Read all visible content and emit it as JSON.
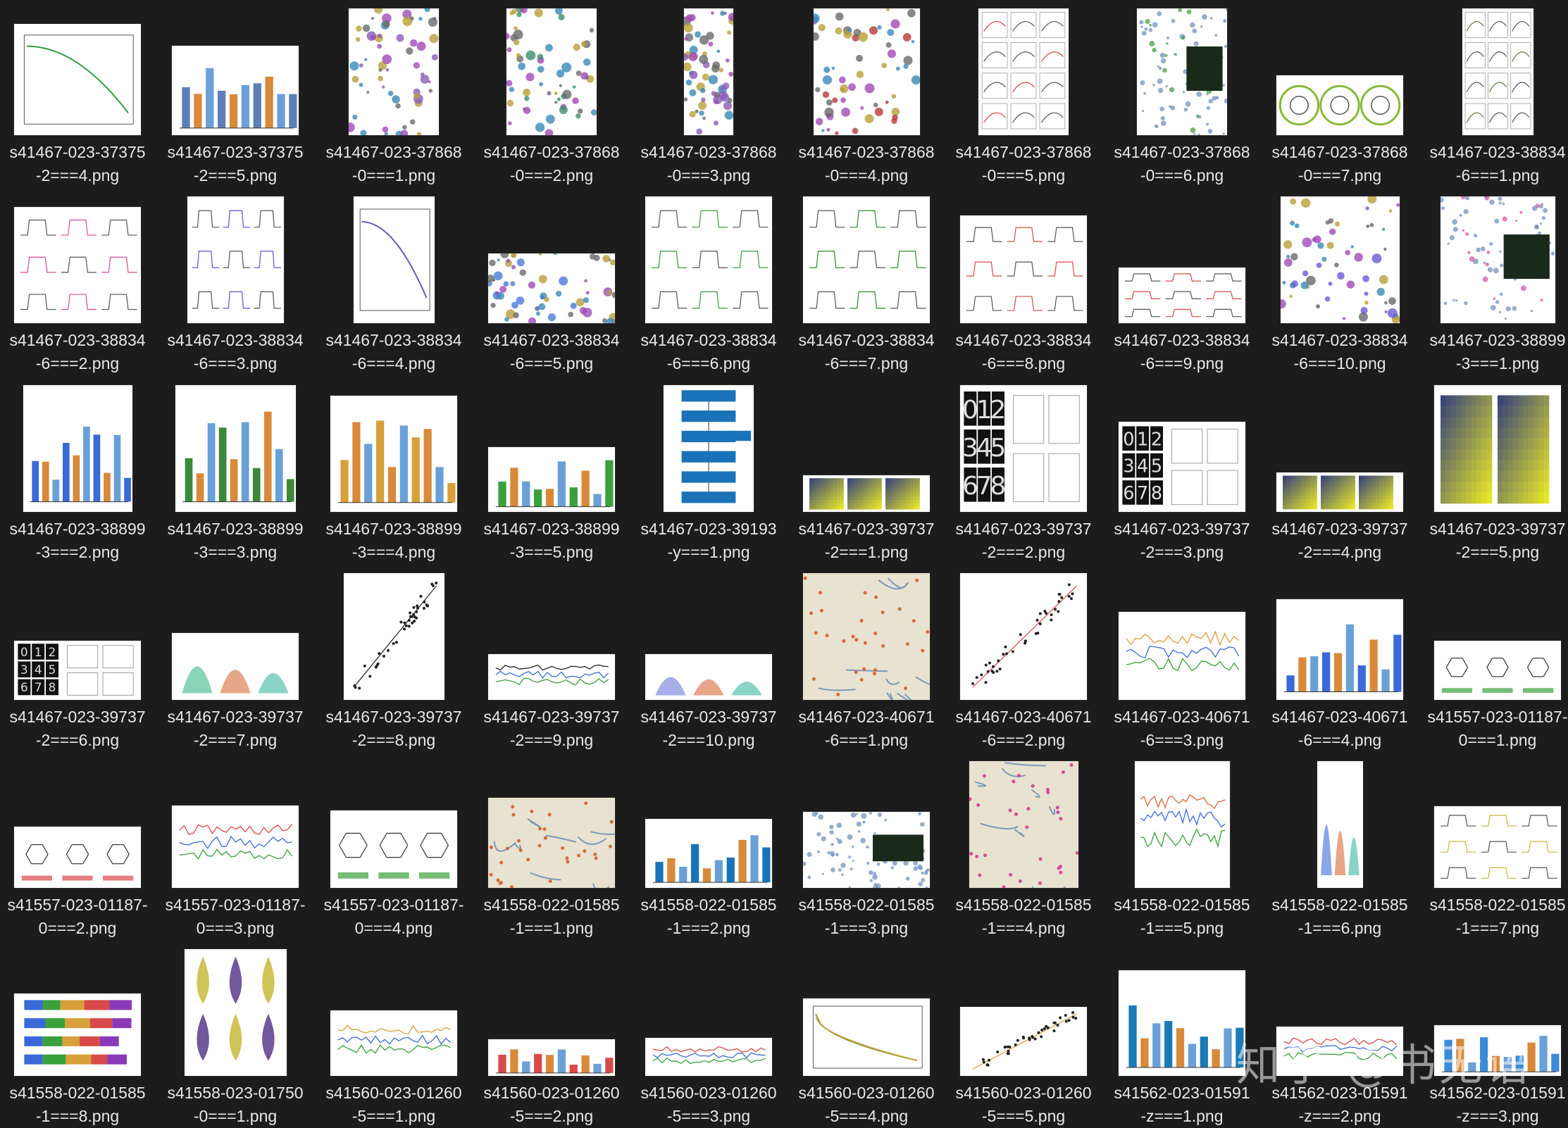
{
  "watermark": "知乎 @书无语",
  "files": [
    {
      "name": "s41467-023-37375-2===4.png",
      "w": 180,
      "h": 158,
      "kind": "curve",
      "accent": "#2ea043"
    },
    {
      "name": "s41467-023-37375-2===5.png",
      "w": 180,
      "h": 127,
      "kind": "bars",
      "accent": "#5b7fb8"
    },
    {
      "name": "s41467-023-37868-0===1.png",
      "w": 128,
      "h": 180,
      "kind": "cluster",
      "accent": "#8a5cb8"
    },
    {
      "name": "s41467-023-37868-0===2.png",
      "w": 128,
      "h": 180,
      "kind": "cluster",
      "accent": "#3a8f6a"
    },
    {
      "name": "s41467-023-37868-0===3.png",
      "w": 70,
      "h": 180,
      "kind": "cluster",
      "accent": "#8a5cb8"
    },
    {
      "name": "s41467-023-37868-0===4.png",
      "w": 151,
      "h": 180,
      "kind": "cluster",
      "accent": "#b83a3a"
    },
    {
      "name": "s41467-023-37868-0===5.png",
      "w": 128,
      "h": 180,
      "kind": "panels",
      "accent": "#d84040"
    },
    {
      "name": "s41467-023-37868-0===6.png",
      "w": 128,
      "h": 180,
      "kind": "dots",
      "accent": "#3a9a3a"
    },
    {
      "name": "s41467-023-37868-0===7.png",
      "w": 180,
      "h": 85,
      "kind": "ring",
      "accent": "#8ab83a"
    },
    {
      "name": "s41467-023-38834-6===1.png",
      "w": 101,
      "h": 180,
      "kind": "panels",
      "accent": "#5a7a3a"
    },
    {
      "name": "s41467-023-38834-6===2.png",
      "w": 180,
      "h": 165,
      "kind": "traces",
      "accent": "#d84a9a"
    },
    {
      "name": "s41467-023-38834-6===3.png",
      "w": 137,
      "h": 180,
      "kind": "traces",
      "accent": "#6a4ad8"
    },
    {
      "name": "s41467-023-38834-6===4.png",
      "w": 115,
      "h": 180,
      "kind": "curve",
      "accent": "#6a5ab8"
    },
    {
      "name": "s41467-023-38834-6===5.png",
      "w": 180,
      "h": 99,
      "kind": "cluster",
      "accent": "#4a7ad8"
    },
    {
      "name": "s41467-023-38834-6===6.png",
      "w": 180,
      "h": 180,
      "kind": "traces",
      "accent": "#3a9a3a"
    },
    {
      "name": "s41467-023-38834-6===7.png",
      "w": 180,
      "h": 180,
      "kind": "traces",
      "accent": "#2a8a2a"
    },
    {
      "name": "s41467-023-38834-6===8.png",
      "w": 180,
      "h": 153,
      "kind": "traces",
      "accent": "#d84a4a"
    },
    {
      "name": "s41467-023-38834-6===9.png",
      "w": 180,
      "h": 79,
      "kind": "traces",
      "accent": "#d84a4a"
    },
    {
      "name": "s41467-023-38834-6===10.png",
      "w": 169,
      "h": 180,
      "kind": "cluster",
      "accent": "#6a5ad8"
    },
    {
      "name": "s41467-023-38899-3===1.png",
      "w": 163,
      "h": 180,
      "kind": "dots",
      "accent": "#d84a9a"
    },
    {
      "name": "s41467-023-38899-3===2.png",
      "w": 155,
      "h": 180,
      "kind": "bars",
      "accent": "#3a6ad8"
    },
    {
      "name": "s41467-023-38899-3===3.png",
      "w": 171,
      "h": 180,
      "kind": "bars",
      "accent": "#3a8a3a"
    },
    {
      "name": "s41467-023-38899-3===4.png",
      "w": 180,
      "h": 165,
      "kind": "bars",
      "accent": "#d8a03a"
    },
    {
      "name": "s41467-023-38899-3===5.png",
      "w": 180,
      "h": 92,
      "kind": "bars",
      "accent": "#3aa03a"
    },
    {
      "name": "s41467-023-39193-y===1.png",
      "w": 128,
      "h": 180,
      "kind": "flow",
      "accent": "#1a73b8"
    },
    {
      "name": "s41467-023-39737-2===1.png",
      "w": 180,
      "h": 52,
      "kind": "heat",
      "accent": "#3a8ab8"
    },
    {
      "name": "s41467-023-39737-2===2.png",
      "w": 180,
      "h": 180,
      "kind": "digits",
      "accent": "#222222"
    },
    {
      "name": "s41467-023-39737-2===3.png",
      "w": 180,
      "h": 128,
      "kind": "digits",
      "accent": "#222222"
    },
    {
      "name": "s41467-023-39737-2===4.png",
      "w": 180,
      "h": 56,
      "kind": "heat",
      "accent": "#3a8ab8"
    },
    {
      "name": "s41467-023-39737-2===5.png",
      "w": 180,
      "h": 180,
      "kind": "heat",
      "accent": "#3a8ab8"
    },
    {
      "name": "s41467-023-39737-2===6.png",
      "w": 180,
      "h": 84,
      "kind": "digits",
      "accent": "#222222"
    },
    {
      "name": "s41467-023-39737-2===7.png",
      "w": 180,
      "h": 95,
      "kind": "peaks",
      "accent": "#3ab88a"
    },
    {
      "name": "s41467-023-39737-2===8.png",
      "w": 143,
      "h": 180,
      "kind": "scatter",
      "accent": "#222222"
    },
    {
      "name": "s41467-023-39737-2===9.png",
      "w": 180,
      "h": 65,
      "kind": "lines",
      "accent": "#222222"
    },
    {
      "name": "s41467-023-39737-2===10.png",
      "w": 180,
      "h": 65,
      "kind": "peaks",
      "accent": "#6a7ad8"
    },
    {
      "name": "s41467-023-40671-6===1.png",
      "w": 180,
      "h": 180,
      "kind": "map",
      "accent": "#d86a3a"
    },
    {
      "name": "s41467-023-40671-6===2.png",
      "w": 180,
      "h": 180,
      "kind": "scatter",
      "accent": "#d84a4a"
    },
    {
      "name": "s41467-023-40671-6===3.png",
      "w": 180,
      "h": 125,
      "kind": "lines",
      "accent": "#d8a03a"
    },
    {
      "name": "s41467-023-40671-6===4.png",
      "w": 180,
      "h": 143,
      "kind": "bars",
      "accent": "#3a6ad8"
    },
    {
      "name": "s41557-023-01187-0===1.png",
      "w": 180,
      "h": 84,
      "kind": "molecule",
      "accent": "#3aa03a"
    },
    {
      "name": "s41557-023-01187-0===2.png",
      "w": 180,
      "h": 87,
      "kind": "molecule",
      "accent": "#d84a4a"
    },
    {
      "name": "s41557-023-01187-0===3.png",
      "w": 180,
      "h": 117,
      "kind": "lines",
      "accent": "#d84a4a"
    },
    {
      "name": "s41557-023-01187-0===4.png",
      "w": 180,
      "h": 110,
      "kind": "molecule",
      "accent": "#3aa03a"
    },
    {
      "name": "s41558-022-01585-1===1.png",
      "w": 180,
      "h": 128,
      "kind": "map",
      "accent": "#d86a3a"
    },
    {
      "name": "s41558-022-01585-1===2.png",
      "w": 180,
      "h": 98,
      "kind": "bars",
      "accent": "#1a73b8"
    },
    {
      "name": "s41558-022-01585-1===3.png",
      "w": 180,
      "h": 108,
      "kind": "dots",
      "accent": "#6a8ab8"
    },
    {
      "name": "s41558-022-01585-1===4.png",
      "w": 155,
      "h": 180,
      "kind": "map",
      "accent": "#d84a9a"
    },
    {
      "name": "s41558-022-01585-1===5.png",
      "w": 135,
      "h": 180,
      "kind": "lines",
      "accent": "#d86a3a"
    },
    {
      "name": "s41558-022-01585-1===6.png",
      "w": 65,
      "h": 180,
      "kind": "peaks",
      "accent": "#3a6ad8"
    },
    {
      "name": "s41558-022-01585-1===7.png",
      "w": 180,
      "h": 116,
      "kind": "traces",
      "accent": "#c8b83a"
    },
    {
      "name": "s41558-022-01585-1===8.png",
      "w": 180,
      "h": 117,
      "kind": "stacked",
      "accent": "#3aa03a"
    },
    {
      "name": "s41558-023-01750-0===1.png",
      "w": 145,
      "h": 180,
      "kind": "violin",
      "accent": "#5a3a8a"
    },
    {
      "name": "s41560-023-01260-5===1.png",
      "w": 180,
      "h": 93,
      "kind": "lines",
      "accent": "#d8a03a"
    },
    {
      "name": "s41560-023-01260-5===2.png",
      "w": 180,
      "h": 52,
      "kind": "bars",
      "accent": "#d84a4a"
    },
    {
      "name": "s41560-023-01260-5===3.png",
      "w": 180,
      "h": 54,
      "kind": "lines",
      "accent": "#d84a4a"
    },
    {
      "name": "s41560-023-01260-5===4.png",
      "w": 180,
      "h": 110,
      "kind": "decay",
      "accent": "#8aa03a"
    },
    {
      "name": "s41560-023-01260-5===5.png",
      "w": 180,
      "h": 98,
      "kind": "scatter",
      "accent": "#d8a03a"
    },
    {
      "name": "s41562-023-01591-z===1.png",
      "w": 180,
      "h": 150,
      "kind": "bars",
      "accent": "#1a7ab8"
    },
    {
      "name": "s41562-023-01591-z===2.png",
      "w": 180,
      "h": 70,
      "kind": "lines",
      "accent": "#d84a4a"
    },
    {
      "name": "s41562-023-01591-z===3.png",
      "w": 180,
      "h": 72,
      "kind": "bars",
      "accent": "#3a8ad8"
    }
  ]
}
